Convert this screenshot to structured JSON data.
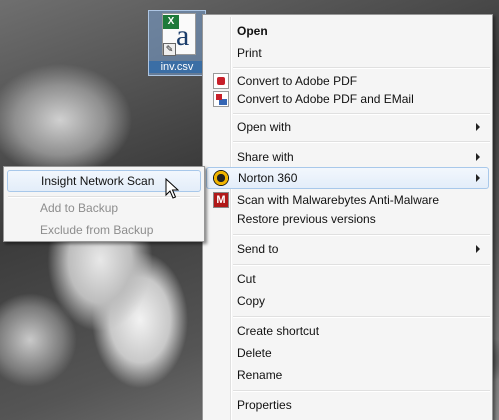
{
  "desktop": {
    "file": {
      "name": "inv.csv",
      "label": "inv.csv",
      "glyph": "a",
      "excel_badge": "X"
    }
  },
  "context_menu": {
    "items": [
      {
        "label": "Open"
      },
      {
        "label": "Print"
      },
      {
        "label": "Convert to Adobe PDF",
        "icon": "adobe-pdf-icon"
      },
      {
        "label": "Convert to Adobe PDF and EMail",
        "icon": "adobe-pdf-email-icon"
      },
      {
        "label": "Open with"
      },
      {
        "label": "Share with"
      },
      {
        "label": "Norton 360",
        "icon": "norton-icon"
      },
      {
        "label": "Scan with Malwarebytes Anti-Malware",
        "icon": "malwarebytes-icon"
      },
      {
        "label": "Restore previous versions"
      },
      {
        "label": "Send to"
      },
      {
        "label": "Cut"
      },
      {
        "label": "Copy"
      },
      {
        "label": "Create shortcut"
      },
      {
        "label": "Delete"
      },
      {
        "label": "Rename"
      },
      {
        "label": "Properties"
      }
    ]
  },
  "norton_submenu": {
    "items": [
      {
        "label": "Insight Network Scan"
      },
      {
        "label": "Add to Backup"
      },
      {
        "label": "Exclude from Backup"
      }
    ]
  },
  "colors": {
    "menu_background": "#f5f5f5",
    "highlight_background": "#e3edf9",
    "highlight_border": "#a8c8ea",
    "disabled_text": "#8d8d8d"
  }
}
